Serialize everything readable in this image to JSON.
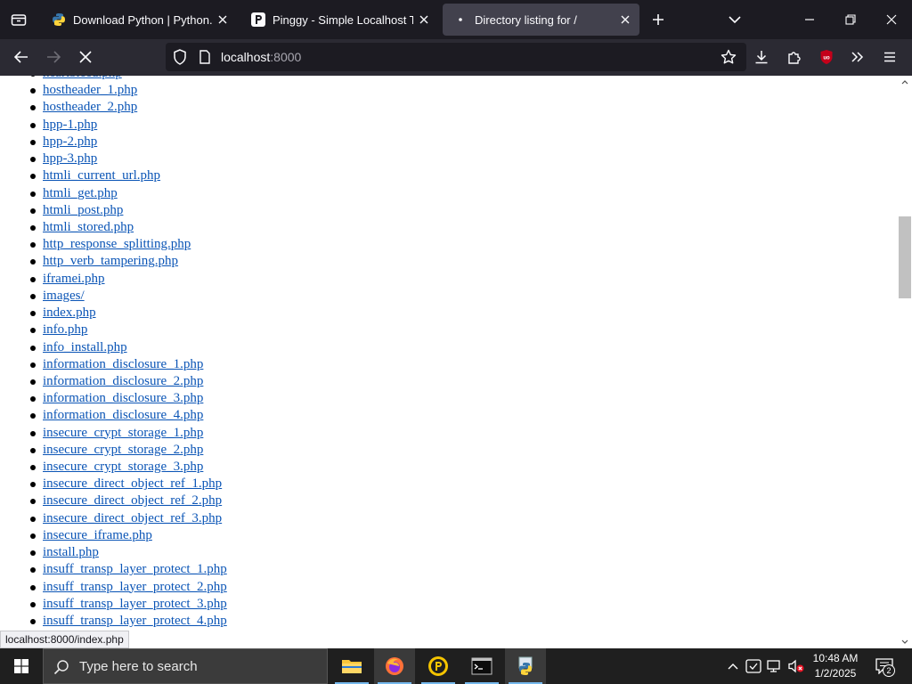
{
  "browser": {
    "tabs": [
      {
        "title": "Download Python | Python.org",
        "icon": "python-icon",
        "active": false
      },
      {
        "title": "Pinggy - Simple Localhost Tunnels",
        "icon": "pinggy-icon",
        "active": false
      },
      {
        "title": "Directory listing for /",
        "icon": "loading-dot-icon",
        "active": true
      }
    ],
    "url_host": "localhost",
    "url_port": ":8000"
  },
  "page": {
    "files": [
      "heartbleed.php",
      "hostheader_1.php",
      "hostheader_2.php",
      "hpp-1.php",
      "hpp-2.php",
      "hpp-3.php",
      "htmli_current_url.php",
      "htmli_get.php",
      "htmli_post.php",
      "htmli_stored.php",
      "http_response_splitting.php",
      "http_verb_tampering.php",
      "iframei.php",
      "images/",
      "index.php",
      "info.php",
      "info_install.php",
      "information_disclosure_1.php",
      "information_disclosure_2.php",
      "information_disclosure_3.php",
      "information_disclosure_4.php",
      "insecure_crypt_storage_1.php",
      "insecure_crypt_storage_2.php",
      "insecure_crypt_storage_3.php",
      "insecure_direct_object_ref_1.php",
      "insecure_direct_object_ref_2.php",
      "insecure_direct_object_ref_3.php",
      "insecure_iframe.php",
      "install.php",
      "insuff_transp_layer_protect_1.php",
      "insuff_transp_layer_protect_2.php",
      "insuff_transp_layer_protect_3.php",
      "insuff_transp_layer_protect_4.php"
    ]
  },
  "status_bar": {
    "text": "localhost:8000/index.php"
  },
  "taskbar": {
    "search_placeholder": "Type here to search",
    "time": "10:48 AM",
    "date": "1/2/2025",
    "notification_count": "2"
  }
}
